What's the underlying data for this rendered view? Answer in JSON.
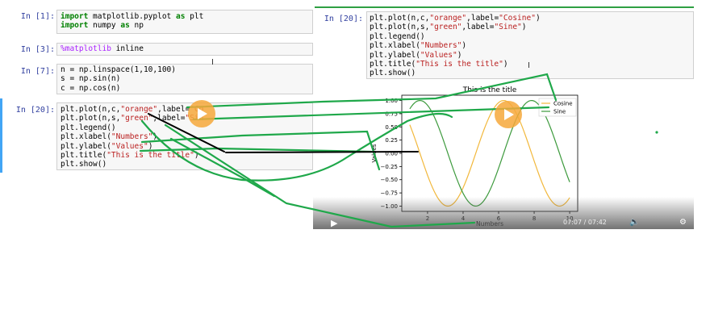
{
  "notebook": {
    "cells": [
      {
        "prompt": "In [1]:",
        "lines": [
          [
            {
              "t": "import",
              "c": "kw"
            },
            {
              "t": " matplotlib.pyplot "
            },
            {
              "t": "as",
              "c": "kw"
            },
            {
              "t": " plt"
            }
          ],
          [
            {
              "t": "import",
              "c": "kw"
            },
            {
              "t": " numpy "
            },
            {
              "t": "as",
              "c": "kw"
            },
            {
              "t": " np"
            }
          ]
        ]
      },
      {
        "prompt": "In [3]:",
        "lines": [
          [
            {
              "t": "%matplotlib",
              "c": "mg"
            },
            {
              "t": " inline"
            }
          ]
        ]
      },
      {
        "prompt": "In [7]:",
        "lines": [
          [
            {
              "t": "n = np.linspace(1,10,100)"
            }
          ],
          [
            {
              "t": "s = np.sin(n)"
            }
          ],
          [
            {
              "t": "c = np.cos(n)"
            }
          ]
        ]
      },
      {
        "prompt": "In [20]:",
        "lines": [
          [
            {
              "t": "plt.plot(n,c,"
            },
            {
              "t": "\"orange\"",
              "c": "str"
            },
            {
              "t": ",label="
            },
            {
              "t": "\"Co",
              "c": "str"
            }
          ],
          [
            {
              "t": "plt.plot(n,s,"
            },
            {
              "t": "\"green\"",
              "c": "str"
            },
            {
              "t": ",label="
            },
            {
              "t": "\"Sin",
              "c": "str"
            }
          ],
          [
            {
              "t": "plt.legend()"
            }
          ],
          [
            {
              "t": "plt.xlabel("
            },
            {
              "t": "\"Numbers\"",
              "c": "str"
            },
            {
              "t": ")"
            }
          ],
          [
            {
              "t": "plt.ylabel("
            },
            {
              "t": "\"Values\"",
              "c": "str"
            },
            {
              "t": ")"
            }
          ],
          [
            {
              "t": "plt.title("
            },
            {
              "t": "\"This is the title\"",
              "c": "str"
            },
            {
              "t": ")"
            }
          ],
          [
            {
              "t": "plt.show()"
            }
          ]
        ]
      }
    ],
    "overlay_cell": {
      "prompt": "In [20]:",
      "lines": [
        [
          {
            "t": "plt.plot(n,c,"
          },
          {
            "t": "\"orange\"",
            "c": "str"
          },
          {
            "t": ",label="
          },
          {
            "t": "\"Cosine\"",
            "c": "str"
          },
          {
            "t": ")"
          }
        ],
        [
          {
            "t": "plt.plot(n,s,"
          },
          {
            "t": "\"green\"",
            "c": "str"
          },
          {
            "t": ",label="
          },
          {
            "t": "\"Sine\"",
            "c": "str"
          },
          {
            "t": ")"
          }
        ],
        [
          {
            "t": "plt.legend()"
          }
        ],
        [
          {
            "t": "plt.xlabel("
          },
          {
            "t": "\"Numbers\"",
            "c": "str"
          },
          {
            "t": ")"
          }
        ],
        [
          {
            "t": "plt.ylabel("
          },
          {
            "t": "\"Values\"",
            "c": "str"
          },
          {
            "t": ")"
          }
        ],
        [
          {
            "t": "plt.title("
          },
          {
            "t": "\"This is the title\"",
            "c": "str"
          },
          {
            "t": ")"
          }
        ],
        [
          {
            "t": "plt.show()"
          }
        ]
      ]
    }
  },
  "chart_data": {
    "type": "line",
    "title": "This is the title",
    "xlabel": "Numbers",
    "ylabel": "Values",
    "xlim": [
      0.55,
      10.45
    ],
    "ylim": [
      -1.1,
      1.1
    ],
    "xticks": [
      2,
      4,
      6,
      8,
      10
    ],
    "yticks": [
      1.0,
      0.75,
      0.5,
      0.25,
      0.0,
      -0.25,
      -0.5,
      -0.75,
      -1.0
    ],
    "ytick_labels": [
      "1.00",
      "0.75",
      "0.50",
      "0.25",
      "0.00",
      "−0.25",
      "−0.50",
      "−0.75",
      "−1.00"
    ],
    "x_function": "linspace(1,10,100)",
    "series": [
      {
        "name": "Cosine",
        "function": "cos",
        "color": "#f2b83c"
      },
      {
        "name": "Sine",
        "function": "sin",
        "color": "#3d9a3d"
      }
    ],
    "legend_position": "upper-right",
    "grid": false
  },
  "video_player": {
    "time_text": "07:07 / 07:42",
    "icons": [
      "play-icon",
      "play-icon",
      "skip-forward-icon",
      "volume-icon",
      "settings-icon"
    ],
    "accent_color": "#f6a83b"
  },
  "annotation_colors": {
    "green": "#1fa84a",
    "black": "#000000"
  }
}
